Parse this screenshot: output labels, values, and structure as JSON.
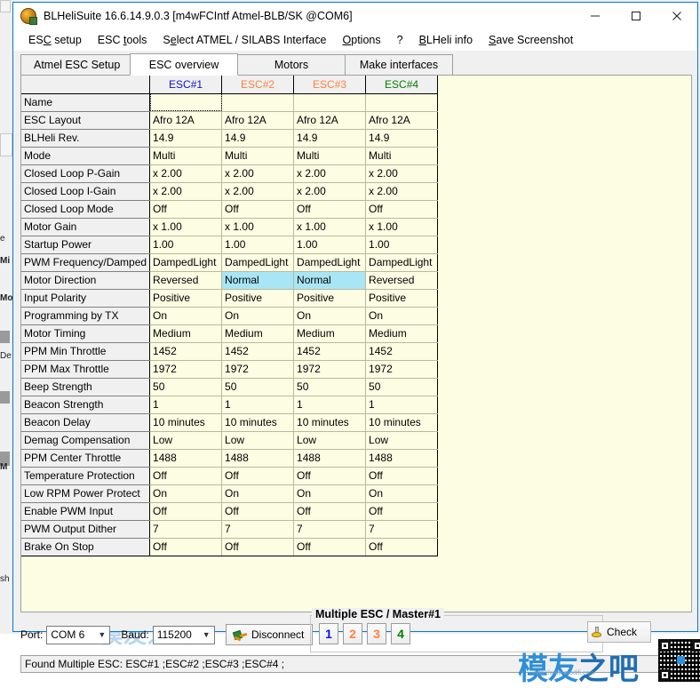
{
  "window": {
    "title": "BLHeliSuite 16.6.14.9.0.3  [m4wFCIntf Atmel-BLB/SK @COM6]",
    "minimize_label": "Minimize",
    "maximize_label": "Maximize",
    "close_label": "Close"
  },
  "menu": [
    {
      "label": "ESC setup"
    },
    {
      "label": "ESC tools"
    },
    {
      "label": "Select ATMEL / SILABS Interface"
    },
    {
      "label": "Options"
    },
    {
      "label": "?"
    },
    {
      "label": "BLHeli info"
    },
    {
      "label": "Save Screenshot"
    }
  ],
  "tabs": [
    {
      "label": "Atmel ESC Setup",
      "active": false
    },
    {
      "label": "ESC overview",
      "active": true
    },
    {
      "label": "Motors",
      "active": false
    },
    {
      "label": "Make interfaces",
      "active": false
    }
  ],
  "grid": {
    "corner_label": "",
    "columns": [
      "ESC#1",
      "ESC#2",
      "ESC#3",
      "ESC#4"
    ],
    "rows": [
      {
        "label": "Name",
        "values": [
          "",
          "",
          "",
          ""
        ]
      },
      {
        "label": "ESC Layout",
        "values": [
          "Afro 12A",
          "Afro 12A",
          "Afro 12A",
          "Afro 12A"
        ]
      },
      {
        "label": "BLHeli Rev.",
        "values": [
          "14.9",
          "14.9",
          "14.9",
          "14.9"
        ]
      },
      {
        "label": "Mode",
        "values": [
          "Multi",
          "Multi",
          "Multi",
          "Multi"
        ]
      },
      {
        "label": "Closed Loop P-Gain",
        "values": [
          "x 2.00",
          "x 2.00",
          "x 2.00",
          "x 2.00"
        ]
      },
      {
        "label": "Closed Loop I-Gain",
        "values": [
          "x 2.00",
          "x 2.00",
          "x 2.00",
          "x 2.00"
        ]
      },
      {
        "label": "Closed Loop Mode",
        "values": [
          "Off",
          "Off",
          "Off",
          "Off"
        ]
      },
      {
        "label": "Motor Gain",
        "values": [
          "x 1.00",
          "x 1.00",
          "x 1.00",
          "x 1.00"
        ]
      },
      {
        "label": "Startup Power",
        "values": [
          "1.00",
          "1.00",
          "1.00",
          "1.00"
        ]
      },
      {
        "label": "PWM Frequency/Damped",
        "values": [
          "DampedLight",
          "DampedLight",
          "DampedLight",
          "DampedLight"
        ]
      },
      {
        "label": "Motor Direction",
        "values": [
          "Reversed",
          "Normal",
          "Normal",
          "Reversed"
        ]
      },
      {
        "label": "Input Polarity",
        "values": [
          "Positive",
          "Positive",
          "Positive",
          "Positive"
        ]
      },
      {
        "label": "Programming by TX",
        "values": [
          "On",
          "On",
          "On",
          "On"
        ]
      },
      {
        "label": "Motor Timing",
        "values": [
          "Medium",
          "Medium",
          "Medium",
          "Medium"
        ]
      },
      {
        "label": "PPM Min Throttle",
        "values": [
          "1452",
          "1452",
          "1452",
          "1452"
        ]
      },
      {
        "label": "PPM Max Throttle",
        "values": [
          "1972",
          "1972",
          "1972",
          "1972"
        ]
      },
      {
        "label": "Beep Strength",
        "values": [
          "50",
          "50",
          "50",
          "50"
        ]
      },
      {
        "label": "Beacon Strength",
        "values": [
          "1",
          "1",
          "1",
          "1"
        ]
      },
      {
        "label": "Beacon Delay",
        "values": [
          "10 minutes",
          "10 minutes",
          "10 minutes",
          "10 minutes"
        ]
      },
      {
        "label": "Demag Compensation",
        "values": [
          "Low",
          "Low",
          "Low",
          "Low"
        ]
      },
      {
        "label": "PPM Center Throttle",
        "values": [
          "1488",
          "1488",
          "1488",
          "1488"
        ]
      },
      {
        "label": "Temperature Protection",
        "values": [
          "Off",
          "Off",
          "Off",
          "Off"
        ]
      },
      {
        "label": "Low RPM Power Protect",
        "values": [
          "On",
          "On",
          "On",
          "On"
        ]
      },
      {
        "label": "Enable PWM Input",
        "values": [
          "Off",
          "Off",
          "Off",
          "Off"
        ]
      },
      {
        "label": "PWM Output Dither",
        "values": [
          "7",
          "7",
          "7",
          "7"
        ]
      },
      {
        "label": "Brake On Stop",
        "values": [
          "Off",
          "Off",
          "Off",
          "Off"
        ]
      }
    ],
    "bold_rows": [
      "Motor Direction",
      "PPM Min Throttle",
      "PPM Max Throttle",
      "Beep Strength",
      "Beacon Strength"
    ],
    "selected_cells": [
      {
        "row": "Motor Direction",
        "col": 1
      },
      {
        "row": "Motor Direction",
        "col": 2
      }
    ],
    "focused_cell": {
      "row": "Name",
      "col": 0
    },
    "header_colors": [
      "#1010e0",
      "#ff8040",
      "#ff8040",
      "#008000"
    ]
  },
  "bottom": {
    "port_label": "Port:",
    "port_value": "COM 6",
    "baud_label": "Baud:",
    "baud_value": "115200",
    "disconnect_label": "Disconnect",
    "multi_esc_title": "Multiple ESC / Master#1",
    "esc_buttons": [
      "1",
      "2",
      "3",
      "4"
    ],
    "esc_button_colors": [
      "#1010e0",
      "#ff8040",
      "#ff8040",
      "#008000"
    ],
    "check_label": "Check",
    "status_text": "Found Multiple ESC: ESC#1 ;ESC#2 ;ESC#3 ;ESC#4 ;"
  },
  "watermark": {
    "text_part1": "模友",
    "text_part2": "之吧",
    "url": "http://www.modifi.com"
  },
  "background_window": {
    "labels": [
      "e",
      "Mi",
      "Mo",
      "De",
      "M",
      "sh"
    ]
  }
}
